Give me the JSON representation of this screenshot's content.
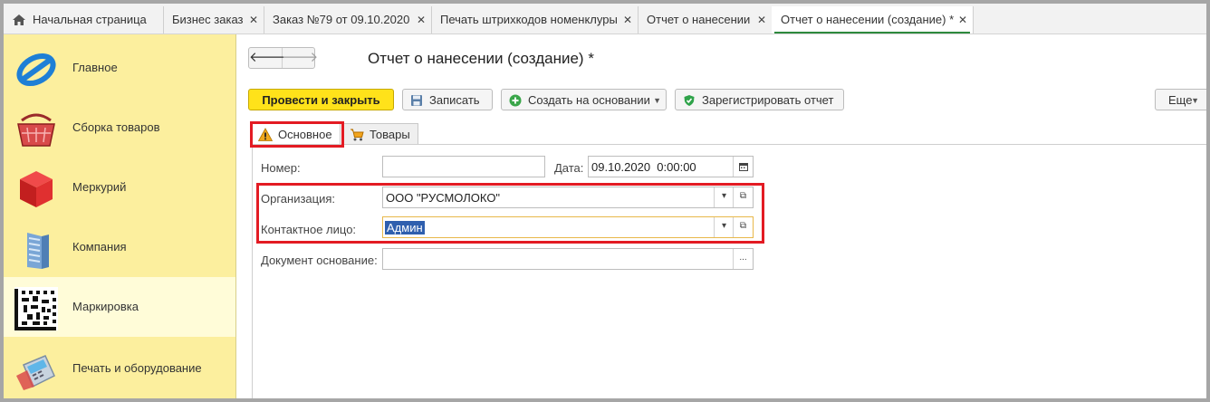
{
  "tabs": [
    {
      "label": "Начальная страница"
    },
    {
      "label": "Бизнес заказ"
    },
    {
      "label": "Заказ №79 от 09.10.2020"
    },
    {
      "label": "Печать штрихкодов номенклуры"
    },
    {
      "label": "Отчет о нанесении"
    },
    {
      "label": "Отчет о нанесении (создание) *"
    }
  ],
  "tab_close_glyph": "✕",
  "sidebar": {
    "items": [
      {
        "label": "Главное",
        "icon": "main-icon"
      },
      {
        "label": "Сборка товаров",
        "icon": "basket-icon"
      },
      {
        "label": "Меркурий",
        "icon": "cube-icon"
      },
      {
        "label": "Компания",
        "icon": "building-icon"
      },
      {
        "label": "Маркировка",
        "icon": "datamatrix-icon"
      },
      {
        "label": "Печать и оборудование",
        "icon": "terminal-icon"
      }
    ],
    "active_index": 4
  },
  "form": {
    "back_glyph": "🡐",
    "forward_glyph": "🡒",
    "title": "Отчет о нанесении (создание) *",
    "toolbar": {
      "post_close": "Провести и закрыть",
      "save": "Записать",
      "create_based": "Создать на основании",
      "register": "Зарегистрировать отчет",
      "more": "Еще"
    },
    "tabs": {
      "main": "Основное",
      "goods": "Товары"
    },
    "fields": {
      "number_label": "Номер:",
      "number_value": "",
      "date_label": "Дата:",
      "date_value": "09.10.2020  0:00:00",
      "org_label": "Организация:",
      "org_value": "ООО \"РУСМОЛОКО\"",
      "contact_label": "Контактное лицо:",
      "contact_value": "Админ",
      "base_label": "Документ основание:",
      "base_value": "",
      "base_button": "..."
    }
  },
  "colors": {
    "sidebar": "#fcef9e",
    "sidebar_active": "#fffcd8",
    "primary_button": "#ffe21a",
    "highlight_box": "#e31b23",
    "active_tab_underline": "#2e8a3e"
  }
}
